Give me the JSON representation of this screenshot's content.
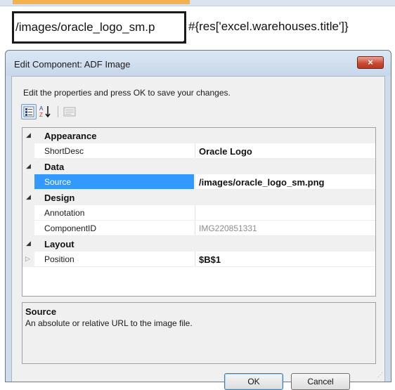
{
  "spreadsheet": {
    "cell_a_text": "/images/oracle_logo_sm.p",
    "cell_b_text": "#{res['excel.warehouses.title']}"
  },
  "dialog": {
    "title": "Edit Component: ADF Image",
    "close_glyph": "×",
    "instructions": "Edit the properties and press OK to save your changes.",
    "toolbar": {
      "categorized_icon": "categorized-icon",
      "sort_icon": "sort-az-icon",
      "property_pages_icon": "property-pages-icon"
    },
    "grid": {
      "categories": [
        {
          "label": "Appearance",
          "properties": [
            {
              "name": "ShortDesc",
              "value": "Oracle Logo"
            }
          ]
        },
        {
          "label": "Data",
          "properties": [
            {
              "name": "Source",
              "value": "/images/oracle_logo_sm.png",
              "selected": true
            }
          ]
        },
        {
          "label": "Design",
          "properties": [
            {
              "name": "Annotation",
              "value": ""
            },
            {
              "name": "ComponentID",
              "value": "IMG220851331",
              "readonly": true
            }
          ]
        },
        {
          "label": "Layout",
          "properties": [
            {
              "name": "Position",
              "value": "$B$1",
              "expandable": true
            }
          ]
        }
      ]
    },
    "description": {
      "title": "Source",
      "text": "An absolute or relative URL to the image file."
    },
    "buttons": {
      "ok": "OK",
      "cancel": "Cancel"
    }
  },
  "colors": {
    "selection": "#3399ff",
    "accent_orange": "#f3b24b",
    "close_red": "#c9452f"
  }
}
